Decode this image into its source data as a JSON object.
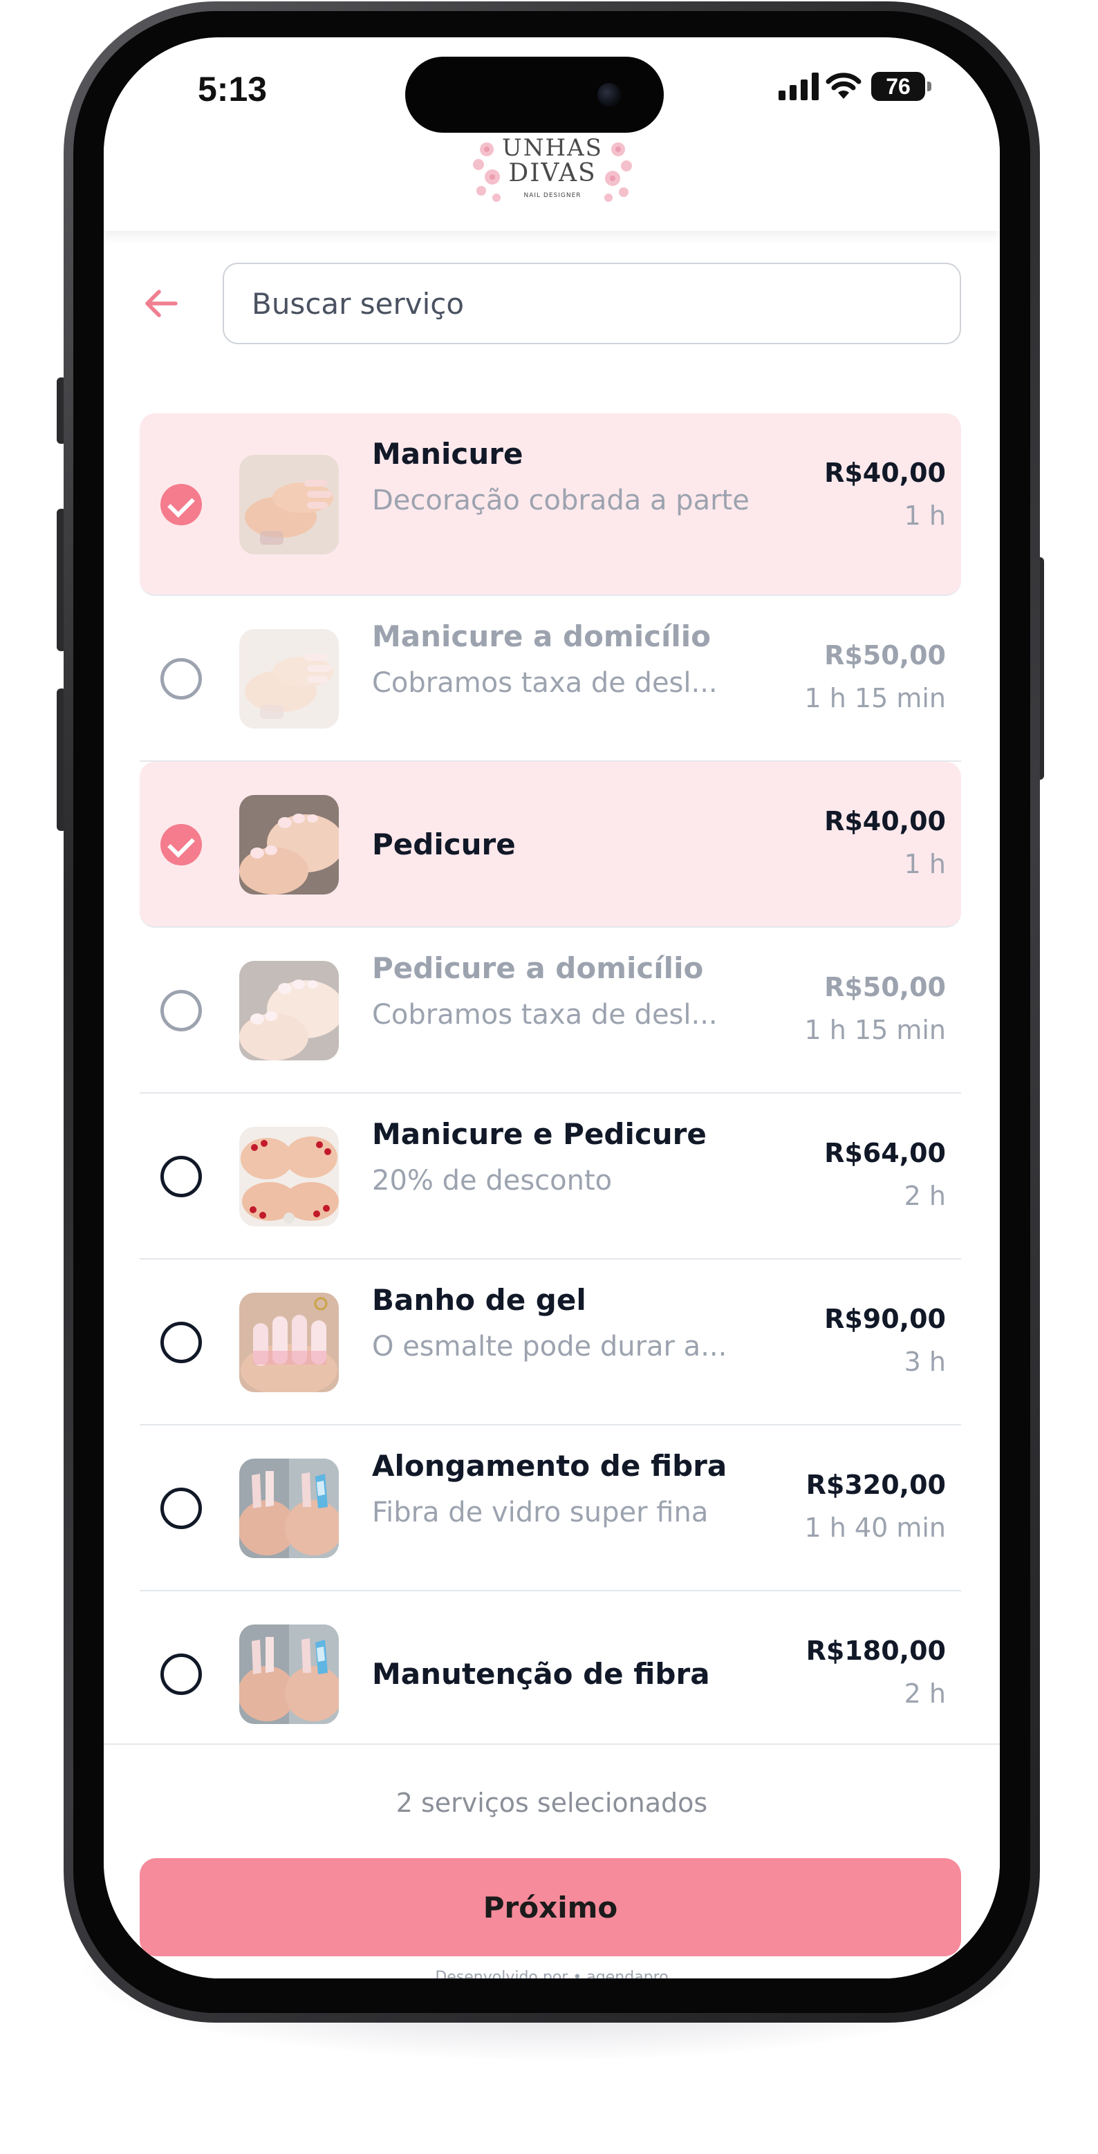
{
  "status_bar": {
    "time": "5:13",
    "battery": "76"
  },
  "header": {
    "logo_line1": "UNHAS",
    "logo_line2": "DIVAS",
    "logo_sub": "NAIL DESIGNER"
  },
  "search": {
    "placeholder": "Buscar serviço",
    "value": ""
  },
  "services": [
    {
      "name": "Manicure",
      "description": "Decoração cobrada a parte",
      "price": "R$40,00",
      "duration": "1 h",
      "selected": true,
      "available": true,
      "icon": "hands-manicure-photo"
    },
    {
      "name": "Manicure a domicílio",
      "description": "Cobramos taxa de desl...",
      "price": "R$50,00",
      "duration": "1 h 15 min",
      "selected": false,
      "available": false,
      "icon": "hands-manicure-photo"
    },
    {
      "name": "Pedicure",
      "description": "",
      "price": "R$40,00",
      "duration": "1 h",
      "selected": true,
      "available": true,
      "icon": "feet-pedicure-photo"
    },
    {
      "name": "Pedicure a domicílio",
      "description": "Cobramos taxa de desl...",
      "price": "R$50,00",
      "duration": "1 h 15 min",
      "selected": false,
      "available": false,
      "icon": "feet-pedicure-photo"
    },
    {
      "name": "Manicure e Pedicure",
      "description": "20% de desconto",
      "price": "R$64,00",
      "duration": "2 h",
      "selected": false,
      "available": true,
      "icon": "red-nails-photo"
    },
    {
      "name": "Banho de gel",
      "description": "O esmalte pode durar a...",
      "price": "R$90,00",
      "duration": "3 h",
      "selected": false,
      "available": true,
      "icon": "gel-nails-photo"
    },
    {
      "name": "Alongamento de fibra",
      "description": "Fibra de vidro super fina",
      "price": "R$320,00",
      "duration": "1 h 40 min",
      "selected": false,
      "available": true,
      "icon": "fiber-nails-photo"
    },
    {
      "name": "Manutenção de fibra",
      "description": "",
      "price": "R$180,00",
      "duration": "2 h",
      "selected": false,
      "available": true,
      "icon": "fiber-nails-photo"
    }
  ],
  "footer": {
    "selected_count": "2 serviços selecionados",
    "next_label": "Próximo",
    "powered_by": "Desenvolvido por • agendapro"
  },
  "colors": {
    "accent": "#f68b9b",
    "selected_bg": "#fde9ec",
    "check": "#f47c8d",
    "text_dark": "#111827",
    "text_muted": "#9ca3af"
  }
}
